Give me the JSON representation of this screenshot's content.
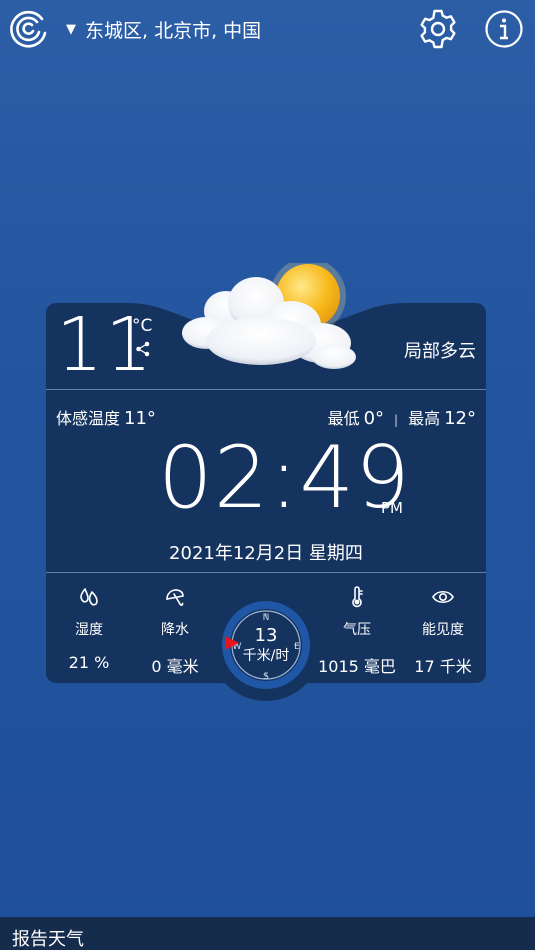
{
  "header": {
    "location": "东城区, 北京市, 中国",
    "icons": [
      "app-logo-icon",
      "caret-down-icon",
      "gear-icon",
      "info-icon"
    ]
  },
  "current": {
    "temperature": "11",
    "unit": "°C",
    "condition": "局部多云",
    "feels_like_label": "体感温度",
    "feels_like_value": "11°",
    "low_label": "最低",
    "low_value": "0°",
    "separator": "|",
    "high_label": "最高",
    "high_value": "12°"
  },
  "clock": {
    "time": "02:49",
    "ampm": "PM",
    "date": "2021年12月2日 星期四"
  },
  "stats": {
    "humidity_label": "湿度",
    "humidity_value": "21 %",
    "precip_label": "降水",
    "precip_value": "0 毫米",
    "pressure_label": "气压",
    "pressure_value": "1015 毫巴",
    "visibility_label": "能见度",
    "visibility_value": "17 千米"
  },
  "wind": {
    "speed": "13",
    "unit": "千米/时",
    "n": "N",
    "e": "E",
    "s": "S",
    "w": "W",
    "arrow_color": "#e8141b"
  },
  "footer": {
    "report_label": "报告天气"
  },
  "colors": {
    "background": "#23559f",
    "card": "#15335f",
    "bottom_bar": "#152c4c"
  }
}
